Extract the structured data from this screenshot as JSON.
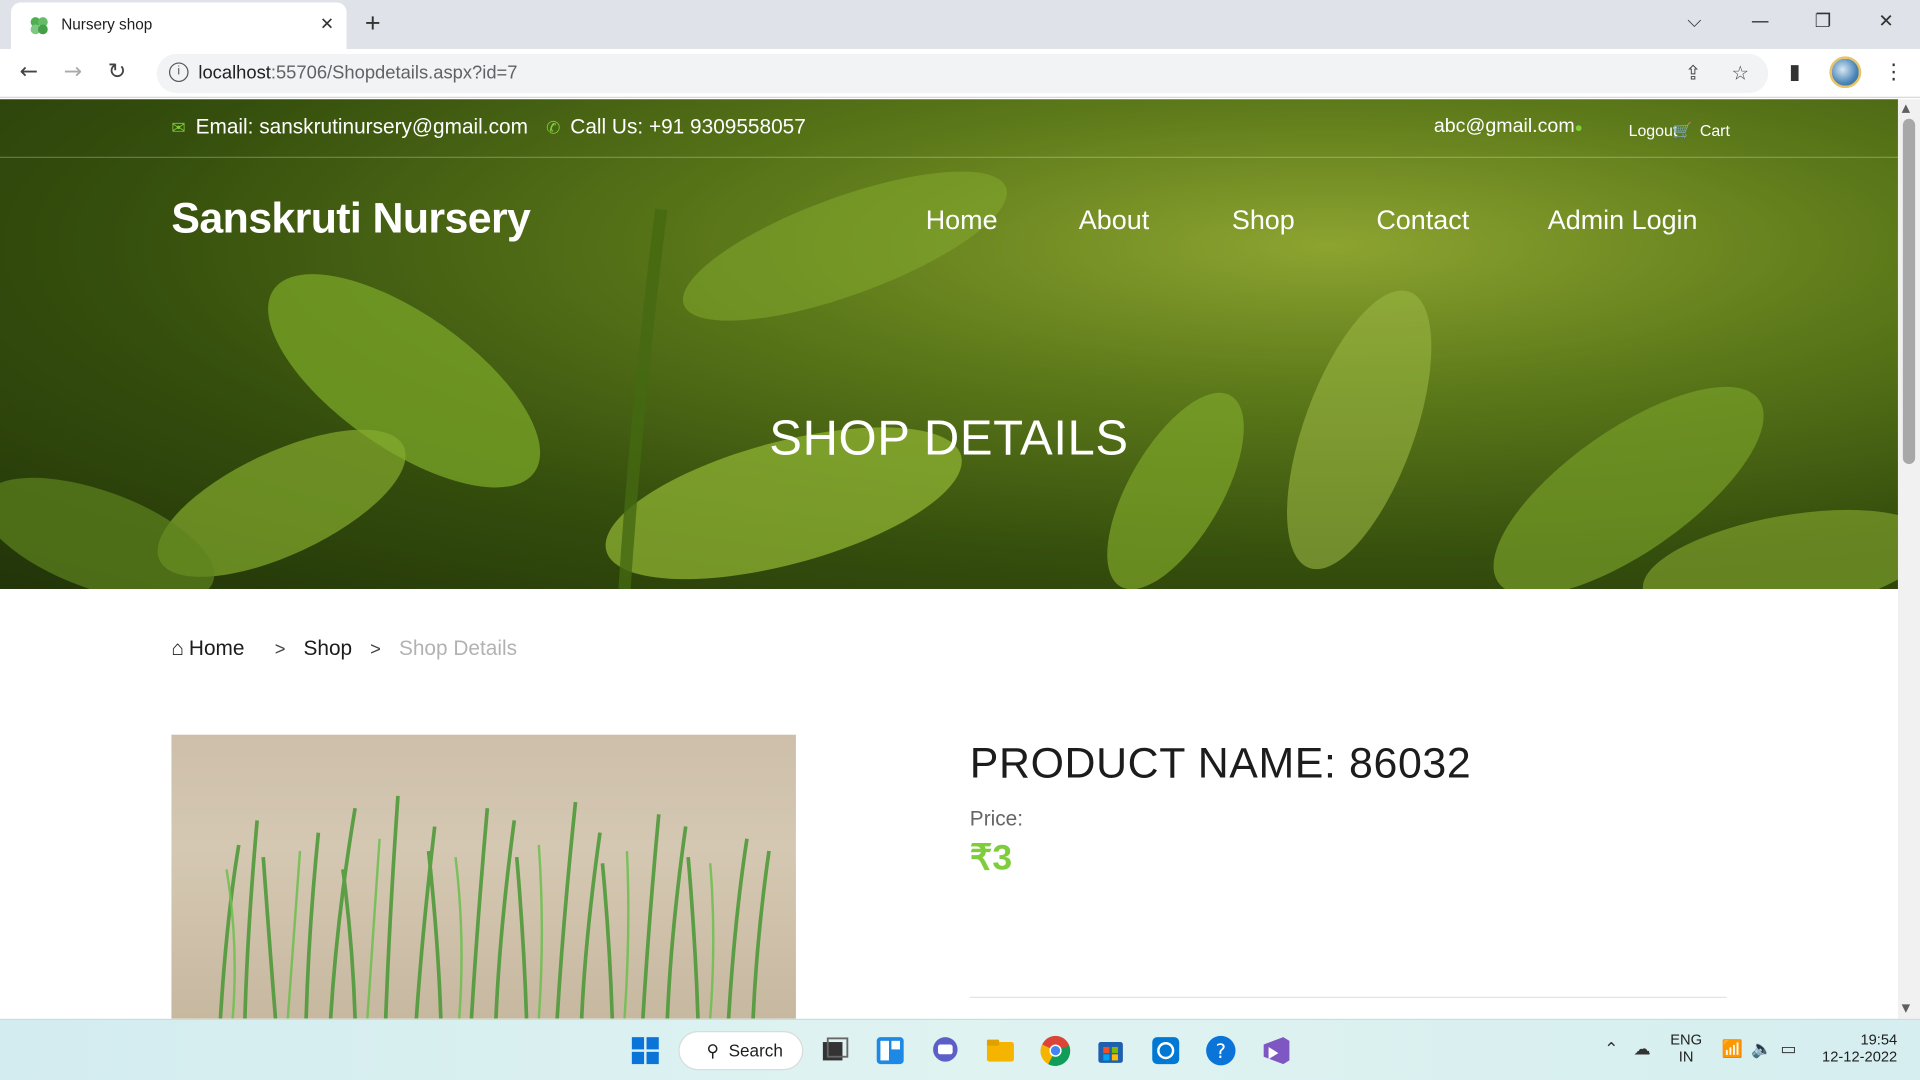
{
  "browser": {
    "tab_title": "Nursery shop",
    "tab_close": "✕",
    "new_tab": "+",
    "url_host": "localhost",
    "url_path": ":55706/Shopdetails.aspx?id=7",
    "controls": {
      "dropdown": "⌵",
      "minimize": "—",
      "restore": "❐",
      "close": "✕"
    }
  },
  "topbar": {
    "email": "Email: sanskrutinursery@gmail.com",
    "call": "Call Us: +91 9309558057",
    "user": "abc@gmail.com",
    "logout": "Logout",
    "cart": "Cart"
  },
  "header": {
    "brand": "Sanskruti Nursery",
    "nav": [
      "Home",
      "About",
      "Shop",
      "Contact",
      "Admin Login"
    ]
  },
  "hero": {
    "title": "SHOP DETAILS"
  },
  "breadcrumb": {
    "home": "Home",
    "shop": "Shop",
    "current": "Shop Details",
    "sep": ">"
  },
  "product": {
    "name": "PRODUCT NAME: 86032",
    "price_label": "Price:",
    "price_value": "₹3"
  },
  "taskbar": {
    "search_label": "Search",
    "lang_top": "ENG",
    "lang_bottom": "IN",
    "time": "19:54",
    "date": "12-12-2022"
  },
  "colors": {
    "accent_green": "#7fcd3a",
    "hero_green": "#6d8f1f"
  }
}
